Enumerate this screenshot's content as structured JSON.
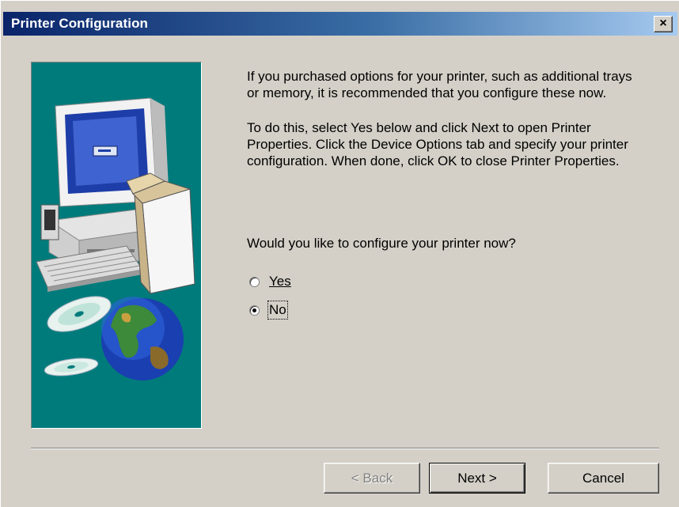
{
  "window": {
    "title": "Printer Configuration",
    "close_label": "×"
  },
  "content": {
    "paragraph1": "If you purchased options for your printer, such as additional trays\nor memory, it is recommended that you configure these now.",
    "paragraph2": "To do this, select Yes below and click Next to open Printer\nProperties. Click the Device Options tab and specify your printer\nconfiguration. When done, click OK to close Printer Properties.",
    "question": "Would you like to configure your printer now?"
  },
  "options": [
    {
      "label": "Yes",
      "selected": false
    },
    {
      "label": "No",
      "selected": true
    }
  ],
  "buttons": {
    "back": "< Back",
    "next": "Next >",
    "cancel": "Cancel"
  },
  "colors": {
    "sidepanel": "#007b7b",
    "titlebar_start": "#0a246a",
    "titlebar_end": "#a6caf0"
  }
}
